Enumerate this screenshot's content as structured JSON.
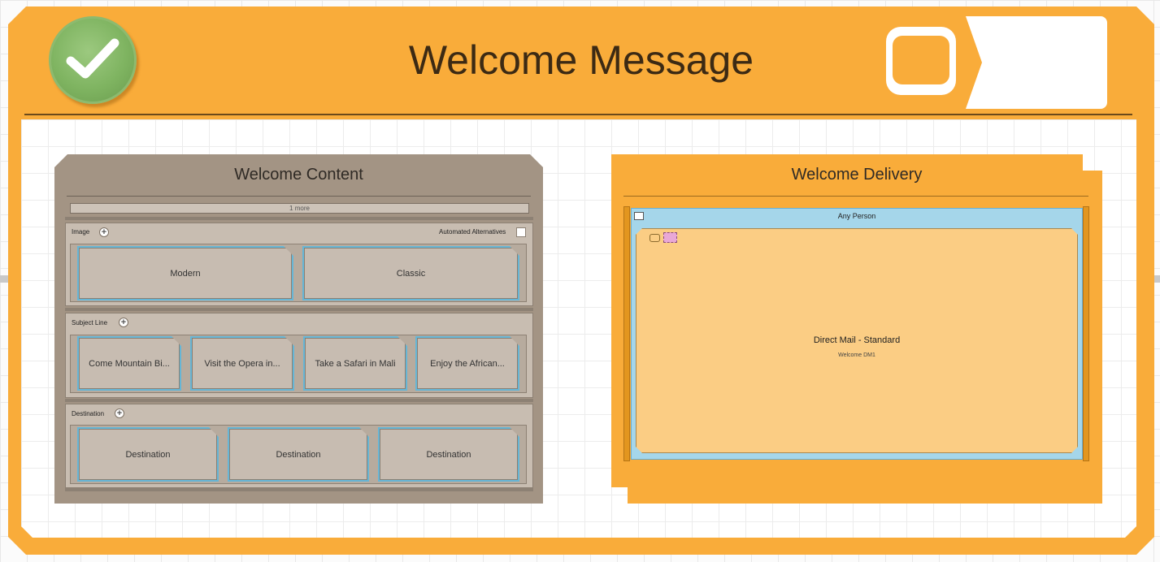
{
  "stage": {
    "title": "Welcome Message"
  },
  "content": {
    "title": "Welcome Content",
    "more_label": "1 more",
    "groups": [
      {
        "label": "Image",
        "extra_label": "Automated Alternatives",
        "variants": [
          "Modern",
          "Classic"
        ]
      },
      {
        "label": "Subject Line",
        "variants": [
          "Come Mountain Bi...",
          "Visit the Opera in...",
          "Take a Safari in Mali",
          "Enjoy the African..."
        ]
      },
      {
        "label": "Destination",
        "variants": [
          "Destination",
          "Destination",
          "Destination"
        ]
      }
    ]
  },
  "delivery": {
    "title": "Welcome Delivery",
    "audience_label": "Any Person",
    "card": {
      "title": "Direct Mail - Standard",
      "subtitle": "Welcome DM1"
    }
  },
  "colors": {
    "frame": "#f9ac3a",
    "content_panel": "#a39484",
    "variant_border": "#66b6d6",
    "audience_bar": "#a5d6ea",
    "card": "#fbcd84",
    "success": "#7fb461"
  },
  "icons": [
    "check-icon",
    "plus-icon",
    "toggle-icon",
    "arrow-tab-icon",
    "card-icon",
    "tag-icon"
  ]
}
